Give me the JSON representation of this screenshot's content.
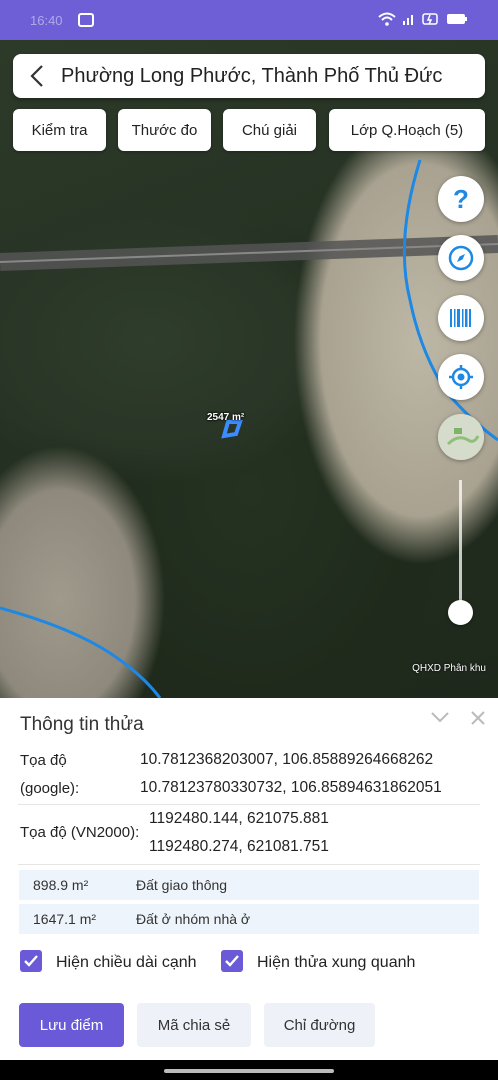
{
  "status_bar": {
    "time": "16:40",
    "screen_icon": "screenshot-icon",
    "wifi_icon": "wifi-icon",
    "signal_icon": "signal-icon",
    "battery_icon": "battery-icon",
    "accent": "#6f5fd6"
  },
  "header": {
    "title": "Phường Long Phước, Thành Phố Thủ Đức"
  },
  "toolbar": {
    "check": "Kiểm tra",
    "ruler": "Thước đo",
    "legend": "Chú giải",
    "layers": "Lớp Q.Hoạch (5)"
  },
  "map": {
    "parcel_area": "2547 m²",
    "layer_label": "QHXD Phân khu",
    "fab_icons": [
      "help-icon",
      "compass-icon",
      "barcode-icon",
      "my-location-icon",
      "map-layer-icon"
    ]
  },
  "panel": {
    "title": "Thông tin thửa",
    "google_label_1": "Tọa độ",
    "google_label_2": "(google):",
    "google_coord_1": "10.7812368203007, 106.85889264668262",
    "google_coord_2": "10.78123780330732, 106.85894631862051",
    "vn2000_label": "Tọa độ (VN2000):",
    "vn2000_coord_1": "1192480.144, 621075.881",
    "vn2000_coord_2": "1192480.274, 621081.751",
    "land_uses": [
      {
        "area": "898.9 m²",
        "type": "Đất giao thông"
      },
      {
        "area": "1647.1 m²",
        "type": "Đất ở nhóm nhà ở"
      }
    ],
    "show_edge_length": "Hiện chiều dài cạnh",
    "show_neighbors": "Hiện thửa xung quanh"
  },
  "actions": {
    "save": "Lưu điểm",
    "share_code": "Mã chia sẻ",
    "directions": "Chỉ đường"
  },
  "colors": {
    "primary": "#6a5ad8",
    "river_line": "#1e88e5"
  }
}
